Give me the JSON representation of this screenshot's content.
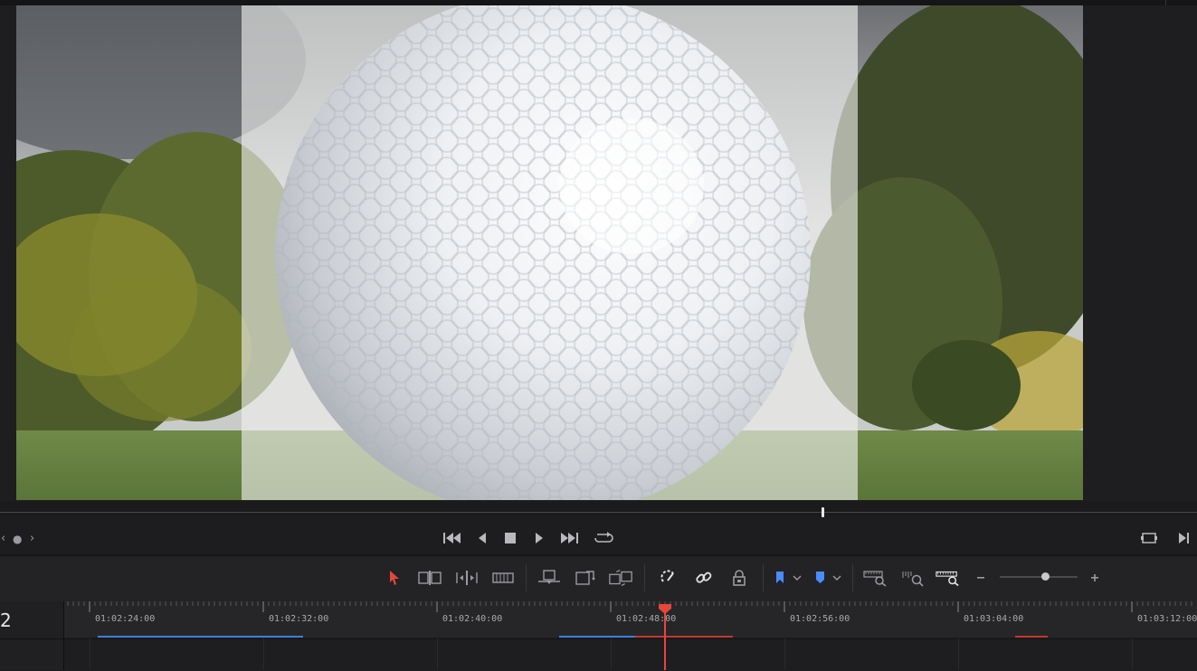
{
  "viewer": {
    "description_free": true
  },
  "transport": {
    "icons": [
      "chevron-left-icon",
      "dot-icon",
      "chevron-right-icon",
      "skip-to-start-icon",
      "play-reverse-icon",
      "stop-icon",
      "play-icon",
      "skip-to-end-icon",
      "loop-icon",
      "fullscreen-icon",
      "next-frame-icon"
    ]
  },
  "toolbar": {
    "icons": [
      "selection-arrow-icon",
      "trim-edit-icon",
      "dynamic-trim-icon",
      "blade-icon",
      "insert-clip-icon",
      "overwrite-clip-icon",
      "replace-clip-icon",
      "snapping-icon",
      "linked-selection-icon",
      "position-lock-icon",
      "flag-icon",
      "marker-icon",
      "zoom-full-icon",
      "zoom-detail-icon",
      "zoom-custom-icon",
      "zoom-out-icon",
      "zoom-in-icon"
    ],
    "accent_color": "#4a8cff",
    "selection_color": "#e8463c"
  },
  "timeline": {
    "track_number": "2",
    "timecodes": [
      "01:02:24:00",
      "01:02:32:00",
      "01:02:40:00",
      "01:02:48:00",
      "01:02:56:00",
      "01:03:04:00",
      "01:03:12:00"
    ],
    "playhead_color": "#e8463c",
    "zoom_level": 0.6
  }
}
